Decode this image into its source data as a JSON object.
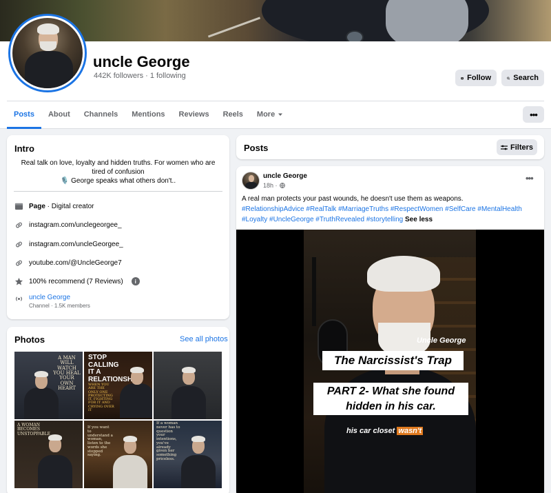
{
  "profile": {
    "name": "uncle George",
    "followers": "442K followers",
    "following": "1 following",
    "separator": "·"
  },
  "header_buttons": {
    "follow": "Follow",
    "search": "Search"
  },
  "tabs": [
    {
      "label": "Posts",
      "active": true
    },
    {
      "label": "About"
    },
    {
      "label": "Channels"
    },
    {
      "label": "Mentions"
    },
    {
      "label": "Reviews"
    },
    {
      "label": "Reels"
    },
    {
      "label": "More"
    }
  ],
  "more_dots": "•••",
  "intro": {
    "title": "Intro",
    "bio_line1": "Real talk on love, loyalty and hidden truths. For women who are tired of confusion",
    "bio_line2": "🎙️ George speaks what others don't..",
    "category_bold": "Page",
    "category_rest": " · Digital creator",
    "link1": "instagram.com/unclegeorgee_",
    "link2": "instagram.com/uncleGeorgee_",
    "link3": "youtube.com/@UncleGeorge7",
    "recommend": "100% recommend (7 Reviews)",
    "channel_name": "uncle George",
    "channel_sub": "Channel · 1.5K members"
  },
  "photos": {
    "title": "Photos",
    "see_all": "See all photos",
    "p1_text": "A MAN WILL WATCH YOU HEAL YOUR OWN HEART",
    "p2_text_big": "STOP CALLING IT A RELATIONSHIP",
    "p2_text_small": "WHEN YOU ARE THE ONLY ONE PROTECTING IT, FIGHTING FOR IT AND CRYING OVER IT",
    "p4_text": "A WOMAN BECOMES UNSTOPPABLE",
    "p5_text": "If you want to understand a woman, listen to the words she stopped saying.",
    "p6_text": "If a woman never has to question your intentions, you've already given her something priceless."
  },
  "posts_header": {
    "title": "Posts",
    "filters": "Filters"
  },
  "post": {
    "author": "uncle George",
    "time": "18h ·",
    "text": "A real man protects your past wounds, he doesn't use them as weapons.",
    "hashtags": "#RelationshipAdvice #RealTalk #MarriageTruths #RespectWomen #SelfCare #MentalHealth #Loyalty #UncleGeorge #TruthRevealed #storytelling",
    "see_less": "See less",
    "menu_dots": "•••",
    "video": {
      "name_caption": "Uncle George",
      "title": "The Narcissist's Trap",
      "part_line1": "PART 2- What she found",
      "part_line2": "hidden in his car.",
      "subtitle_pre": "his car closet",
      "subtitle_highlight": "wasn't"
    }
  },
  "colors": {
    "accent": "#1b74e4",
    "background": "#f0f2f5",
    "button_gray": "#e4e6eb",
    "subtitle_highlight": "#e07a1f"
  }
}
